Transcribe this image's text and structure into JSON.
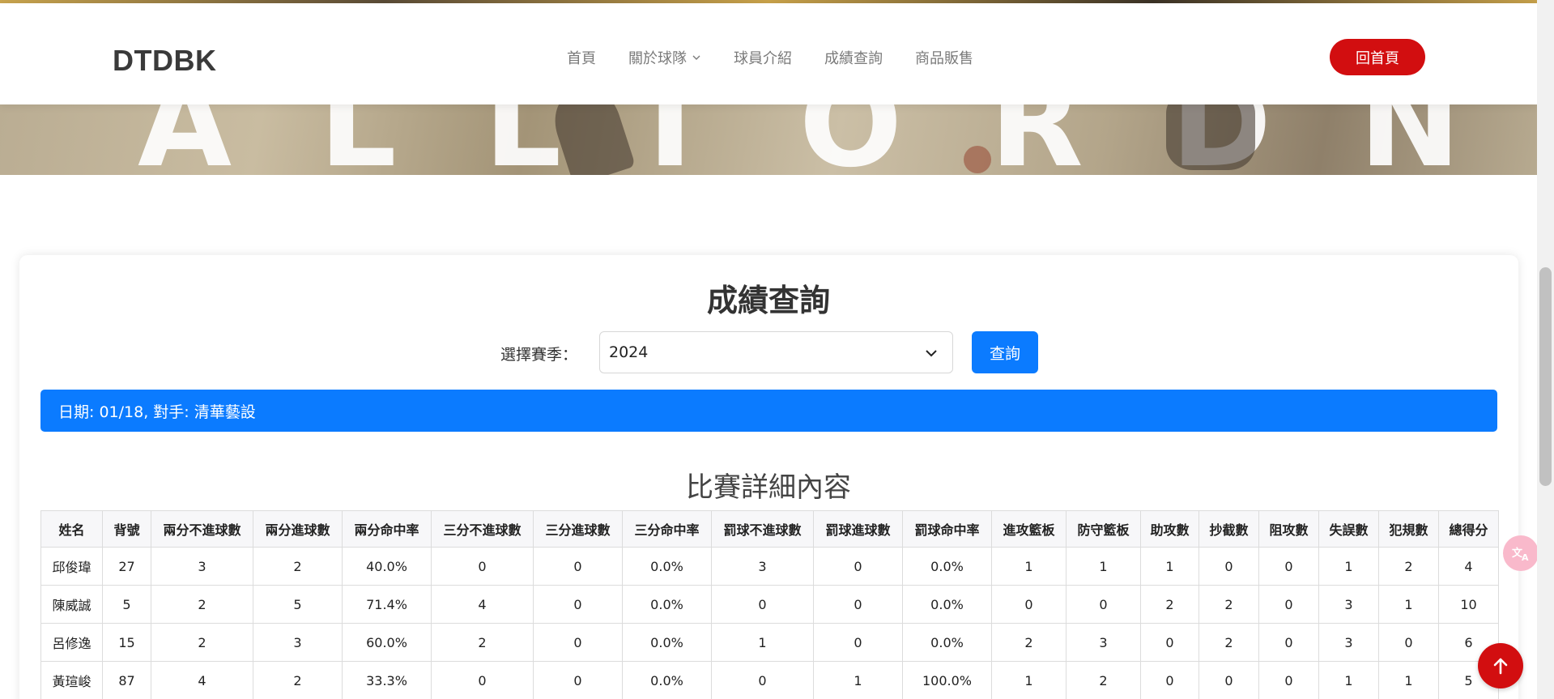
{
  "header": {
    "logo": "DTDBK",
    "nav": [
      "首頁",
      "關於球隊",
      "球員介紹",
      "成績查詢",
      "商品販售"
    ],
    "home_button": "回首頁"
  },
  "hero": {
    "letters": "ALLTORDN"
  },
  "stats": {
    "title": "成績查詢",
    "season_label": "選擇賽季：",
    "season_value": "2024",
    "query_button": "查詢",
    "game_info": "日期: 01/18, 對手: 清華藝設",
    "section_title": "比賽詳細內容",
    "columns": [
      "姓名",
      "背號",
      "兩分不進球數",
      "兩分進球數",
      "兩分命中率",
      "三分不進球數",
      "三分進球數",
      "三分命中率",
      "罰球不進球數",
      "罰球進球數",
      "罰球命中率",
      "進攻籃板",
      "防守籃板",
      "助攻數",
      "抄截數",
      "阻攻數",
      "失誤數",
      "犯規數",
      "總得分"
    ],
    "rows": [
      [
        "邱俊瑋",
        "27",
        "3",
        "2",
        "40.0%",
        "0",
        "0",
        "0.0%",
        "3",
        "0",
        "0.0%",
        "1",
        "1",
        "1",
        "0",
        "0",
        "1",
        "2",
        "4"
      ],
      [
        "陳威誠",
        "5",
        "2",
        "5",
        "71.4%",
        "4",
        "0",
        "0.0%",
        "0",
        "0",
        "0.0%",
        "0",
        "0",
        "2",
        "2",
        "0",
        "3",
        "1",
        "10"
      ],
      [
        "呂修逸",
        "15",
        "2",
        "3",
        "60.0%",
        "2",
        "0",
        "0.0%",
        "1",
        "0",
        "0.0%",
        "2",
        "3",
        "0",
        "2",
        "0",
        "3",
        "0",
        "6"
      ],
      [
        "黃瑄峻",
        "87",
        "4",
        "2",
        "33.3%",
        "0",
        "0",
        "0.0%",
        "0",
        "1",
        "100.0%",
        "1",
        "2",
        "0",
        "0",
        "0",
        "1",
        "1",
        "5"
      ]
    ]
  },
  "colors": {
    "accent_red": "#d20e10",
    "primary_blue": "#0b7bff"
  },
  "icons": {
    "nav_dropdown": "chevron-down-icon",
    "select": "chevron-down-icon",
    "translate": "translate-icon",
    "back_to_top": "arrow-up-icon"
  }
}
